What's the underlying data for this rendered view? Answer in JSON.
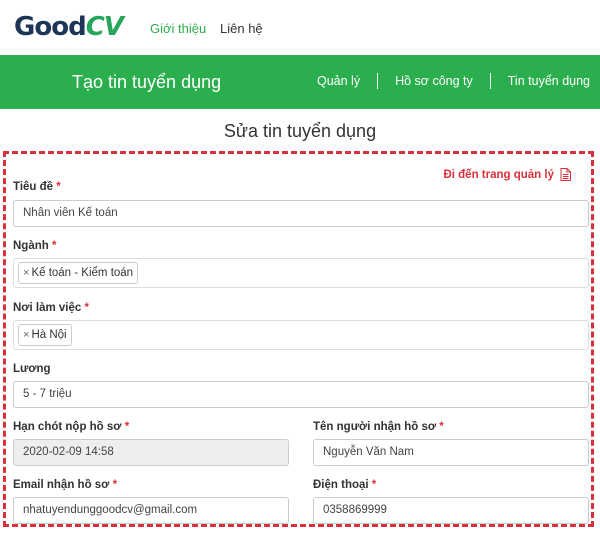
{
  "nav": {
    "logo_part1": "Good",
    "logo_part2": "CV",
    "links": [
      "Giới thiệu",
      "Liên hệ"
    ]
  },
  "banner": {
    "title": "Tạo tin tuyển dụng",
    "menu": [
      "Quản lý",
      "Hồ sơ công ty",
      "Tin tuyển dụng"
    ]
  },
  "page_title": "Sửa tin tuyển dụng",
  "form": {
    "manage_link": "Đi đến trang quản lý",
    "title": {
      "label": "Tiêu đề",
      "value": "Nhân viên Kế toán"
    },
    "industry": {
      "label": "Ngành",
      "tag": "Kế toán - Kiểm toán"
    },
    "location": {
      "label": "Nơi làm việc",
      "tag": "Hà Nội"
    },
    "salary": {
      "label": "Lương",
      "value": "5 - 7 triệu"
    },
    "deadline": {
      "label": "Hạn chót nộp hồ sơ",
      "value": "2020-02-09 14:58"
    },
    "receiver": {
      "label": "Tên người nhận hồ sơ",
      "value": "Nguyễn Văn Nam"
    },
    "email": {
      "label": "Email nhận hồ sơ",
      "value": "nhatuyendunggoodcv@gmail.com"
    },
    "phone": {
      "label": "Điện thoại",
      "value": "0358869999"
    }
  },
  "colors": {
    "brand_green": "#2baf4e",
    "required_red": "#d9303b",
    "navy": "#1d3557"
  }
}
